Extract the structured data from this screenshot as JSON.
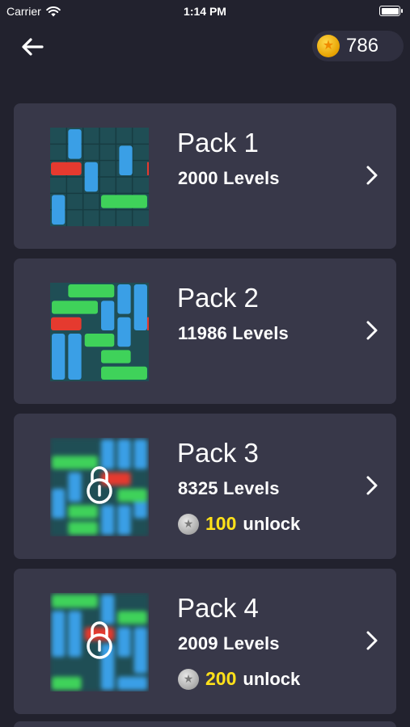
{
  "status_bar": {
    "carrier": "Carrier",
    "time": "1:14 PM"
  },
  "header": {
    "coins": "786",
    "back_icon": "arrow-left-icon",
    "coin_icon": "gold-star-coin-icon"
  },
  "packs": [
    {
      "title": "Pack 1",
      "levels": "2000 Levels",
      "locked": false
    },
    {
      "title": "Pack 2",
      "levels": "11986 Levels",
      "locked": false
    },
    {
      "title": "Pack 3",
      "levels": "8325 Levels",
      "locked": true,
      "price": "100",
      "unlock_label": "unlock"
    },
    {
      "title": "Pack 4",
      "levels": "2009 Levels",
      "locked": true,
      "price": "200",
      "unlock_label": "unlock"
    }
  ],
  "colors": {
    "background": "#22222e",
    "card": "#383849",
    "grid": "#1f4e55",
    "red_block": "#e53a2f",
    "blue_block": "#3a9fe6",
    "green_block": "#3fd25a",
    "price": "#ffe11a"
  }
}
